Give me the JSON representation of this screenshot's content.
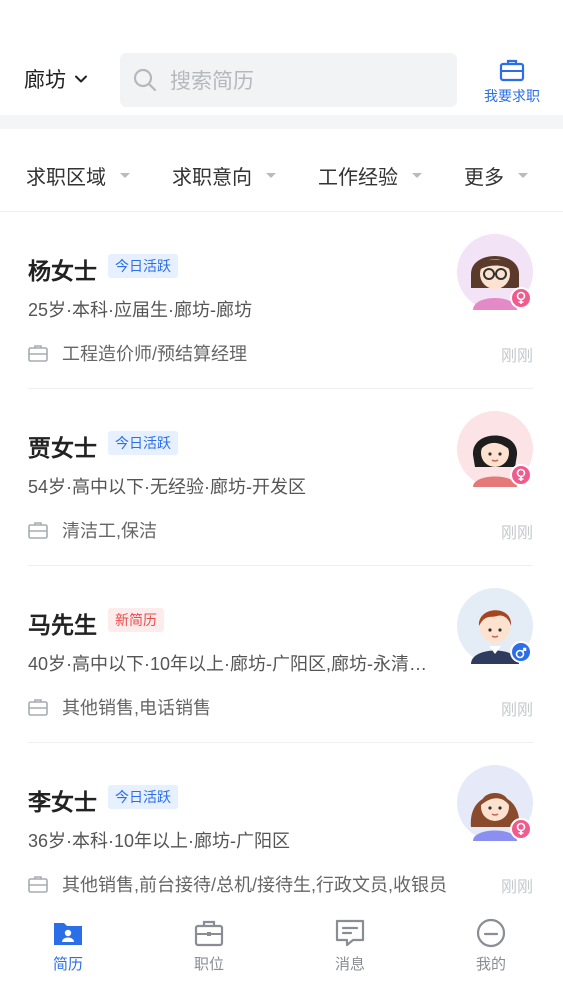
{
  "header": {
    "city": "廊坊",
    "search_placeholder": "搜索简历",
    "job_seek_label": "我要求职"
  },
  "filters": [
    "求职区域",
    "求职意向",
    "工作经验",
    "更多"
  ],
  "resumes": [
    {
      "name": "杨女士",
      "tag": "今日活跃",
      "tag_type": "active",
      "info": "25岁·本科·应届生·廊坊-廊坊",
      "job": "工程造价师/预结算经理",
      "time": "刚刚",
      "gender": "female",
      "avatar": "woman-glasses-avatar"
    },
    {
      "name": "贾女士",
      "tag": "今日活跃",
      "tag_type": "active",
      "info": "54岁·高中以下·无经验·廊坊-开发区",
      "job": "清洁工,保洁",
      "time": "刚刚",
      "gender": "female",
      "avatar": "woman-shorthair-avatar"
    },
    {
      "name": "马先生",
      "tag": "新简历",
      "tag_type": "new",
      "info": "40岁·高中以下·10年以上·廊坊-广阳区,廊坊-永清…",
      "job": "其他销售,电话销售",
      "time": "刚刚",
      "gender": "male",
      "avatar": "man-avatar"
    },
    {
      "name": "李女士",
      "tag": "今日活跃",
      "tag_type": "active",
      "info": "36岁·本科·10年以上·廊坊-广阳区",
      "job": "其他销售,前台接待/总机/接待生,行政文员,收银员",
      "time": "刚刚",
      "gender": "female",
      "avatar": "woman-longhair-avatar"
    }
  ],
  "tabs": [
    {
      "label": "简历",
      "icon": "resume-icon",
      "active": true
    },
    {
      "label": "职位",
      "icon": "briefcase-icon",
      "active": false
    },
    {
      "label": "消息",
      "icon": "message-icon",
      "active": false
    },
    {
      "label": "我的",
      "icon": "profile-icon",
      "active": false
    }
  ],
  "colors": {
    "accent": "#2a6ee8",
    "new_tag": "#ea4b4b",
    "female": "#f05a8c",
    "male": "#2a6ee8"
  }
}
